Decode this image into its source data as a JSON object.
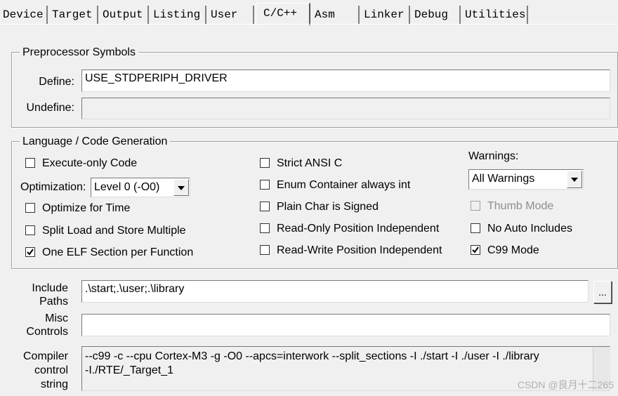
{
  "tabs": [
    {
      "label": "Device"
    },
    {
      "label": "Target"
    },
    {
      "label": "Output"
    },
    {
      "label": "Listing"
    },
    {
      "label": "User"
    },
    {
      "label": "C/C++",
      "active": true
    },
    {
      "label": "Asm"
    },
    {
      "label": "Linker"
    },
    {
      "label": "Debug"
    },
    {
      "label": "Utilities"
    }
  ],
  "preprocessor": {
    "title": "Preprocessor Symbols",
    "define_label": "Define:",
    "define_value": "USE_STDPERIPH_DRIVER",
    "undefine_label": "Undefine:",
    "undefine_value": ""
  },
  "language": {
    "title": "Language / Code Generation",
    "execute_only": {
      "label": "Execute-only Code",
      "checked": false
    },
    "optimization_label": "Optimization:",
    "optimization_value": "Level 0 (-O0)",
    "optimize_time": {
      "label": "Optimize for Time",
      "checked": false
    },
    "split_load": {
      "label": "Split Load and Store Multiple",
      "checked": false
    },
    "one_elf": {
      "label": "One ELF Section per Function",
      "checked": true
    },
    "strict_ansi": {
      "label": "Strict ANSI C",
      "checked": false
    },
    "enum_container": {
      "label": "Enum Container always int",
      "checked": false
    },
    "plain_char": {
      "label": "Plain Char is Signed",
      "checked": false
    },
    "ro_pi": {
      "label": "Read-Only Position Independent",
      "checked": false
    },
    "rw_pi": {
      "label": "Read-Write Position Independent",
      "checked": false
    },
    "warnings_label": "Warnings:",
    "warnings_value": "All Warnings",
    "thumb_mode": {
      "label": "Thumb Mode",
      "checked": false,
      "disabled": true
    },
    "no_auto_includes": {
      "label": "No Auto Includes",
      "checked": false
    },
    "c99_mode": {
      "label": "C99 Mode",
      "checked": true
    }
  },
  "include": {
    "label_line1": "Include",
    "label_line2": "Paths",
    "value": ".\\start;.\\user;.\\library",
    "browse_label": "..."
  },
  "misc": {
    "label_line1": "Misc",
    "label_line2": "Controls",
    "value": ""
  },
  "compiler": {
    "label_line1": "Compiler",
    "label_line2": "control",
    "label_line3": "string",
    "value_line1": "--c99 -c --cpu Cortex-M3 -g -O0 --apcs=interwork --split_sections -I ./start -I ./user -I ./library",
    "value_line2": "-I./RTE/_Target_1"
  },
  "watermark": "CSDN @良月十二265"
}
